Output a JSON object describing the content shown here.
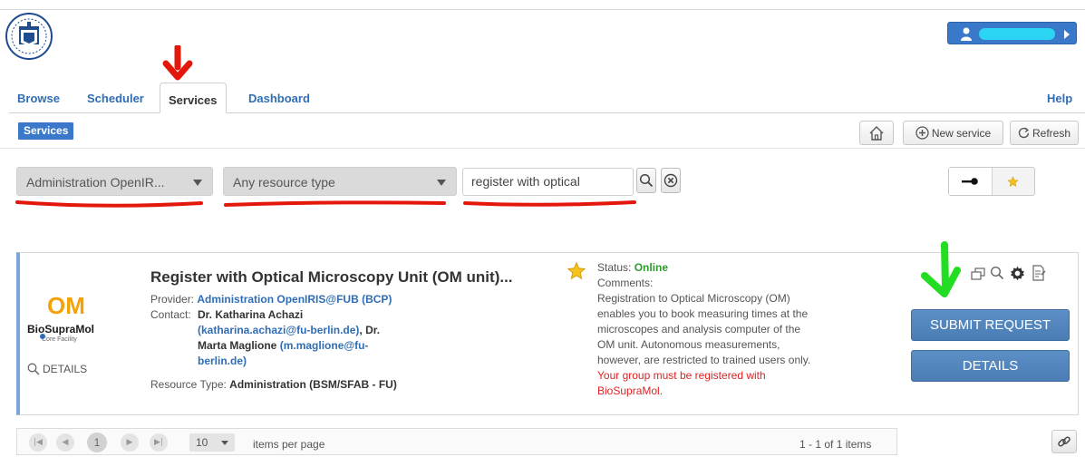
{
  "header": {
    "logo_icon": "university-seal-icon",
    "user_button_icon": "user-icon"
  },
  "tabs": [
    {
      "label": "Browse"
    },
    {
      "label": "Scheduler"
    },
    {
      "label": "Services"
    },
    {
      "label": "Dashboard"
    }
  ],
  "help_label": "Help",
  "breadcrumb": "Services",
  "toolbar": {
    "home_icon": "home-icon",
    "new_service_label": "New service",
    "refresh_label": "Refresh"
  },
  "filters": {
    "provider_select": "Administration OpenIR...",
    "resource_type_select": "Any resource type",
    "search_value": "register with optical"
  },
  "result": {
    "logo_text": "OM",
    "logo_subtext": "BioSupraMol",
    "logo_caption": "Core Facility",
    "details_small": "DETAILS",
    "title": "Register with Optical Microscopy Unit (OM unit)...",
    "provider_label": "Provider:",
    "provider_value": "Administration OpenIRIS@FUB (BCP)",
    "contact_label": "Contact:",
    "contact_name1": "Dr. Katharina Achazi",
    "contact_email1": "(katharina.achazi@fu-berlin.de)",
    "contact_sep": ", Dr.",
    "contact_name2": "Marta Maglione",
    "contact_email2a": "(m.maglione@fu-",
    "contact_email2b": "berlin.de)",
    "resource_type_label": "Resource Type:",
    "resource_type_value": "Administration (BSM/SFAB - FU)",
    "status_label": "Status:",
    "status_value": "Online",
    "comments_label": "Comments:",
    "comment_lines": [
      "Registration to Optical Microscopy (OM)",
      "enables you to book measuring times at the",
      "microscopes and analysis computer of the",
      "OM unit. Autonomous measurements,",
      "however, are restricted to trained users only."
    ],
    "warning_lines": [
      "Your group must be registered with",
      "BioSupraMol."
    ],
    "submit_label": "SUBMIT REQUEST",
    "details_label": "DETAILS"
  },
  "pager": {
    "current_page": "1",
    "page_size": "10",
    "items_per_page_label": "items per page",
    "range_label": "1 - 1 of 1 items"
  },
  "colors": {
    "accent": "#3a78c9",
    "button": "#4a7db4",
    "online": "#2e9a2e",
    "warning": "#e02222",
    "annotation_red": "#e3170a",
    "annotation_green": "#22dd22"
  }
}
